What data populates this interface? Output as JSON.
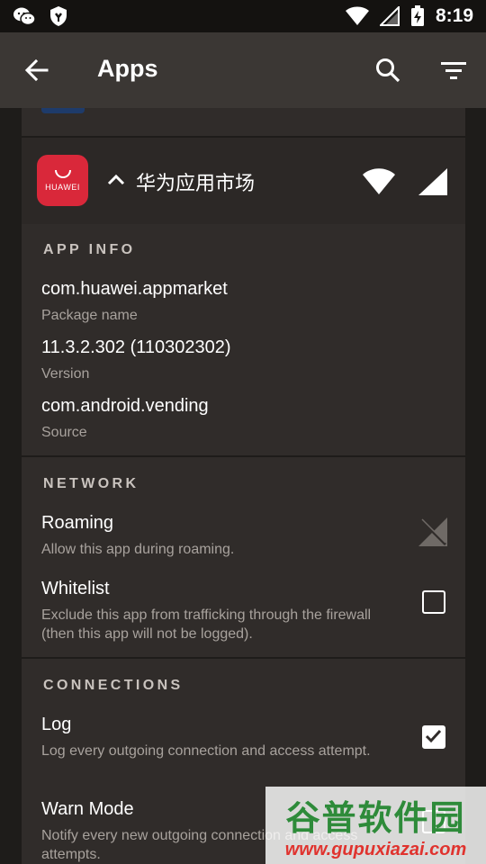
{
  "status_bar": {
    "time": "8:19",
    "icons": [
      "wechat-icon",
      "shield-icon",
      "wifi-icon",
      "signal-icon",
      "battery-charging-icon"
    ]
  },
  "app_bar": {
    "title": "Apps",
    "icons": [
      "back-arrow-icon",
      "search-icon",
      "filter-icon"
    ]
  },
  "app": {
    "name": "华为应用市场",
    "icon_brand": "HUAWEI",
    "icon_color": "#d9283a"
  },
  "app_info": {
    "section_title": "APP INFO",
    "package_value": "com.huawei.appmarket",
    "package_label": "Package name",
    "version_value": "11.3.2.302 (110302302)",
    "version_label": "Version",
    "source_value": "com.android.vending",
    "source_label": "Source"
  },
  "network": {
    "section_title": "NETWORK",
    "roaming_title": "Roaming",
    "roaming_desc": "Allow this app during roaming.",
    "whitelist_title": "Whitelist",
    "whitelist_desc": "Exclude this app from trafficking through the firewall (then this app will not be logged).",
    "whitelist_checked": false
  },
  "connections": {
    "section_title": "CONNECTIONS",
    "log_title": "Log",
    "log_desc": "Log every outgoing connection and access attempt.",
    "log_checked": true,
    "warn_title": "Warn Mode",
    "warn_desc": "Notify every new outgoing connection and access attempts."
  },
  "watermark": {
    "title": "谷普软件园",
    "url": "www.gupuxiazai.com"
  },
  "colors": {
    "background": "#1e1c1a",
    "app_bar": "#3b3734",
    "card": "#302c2a"
  }
}
